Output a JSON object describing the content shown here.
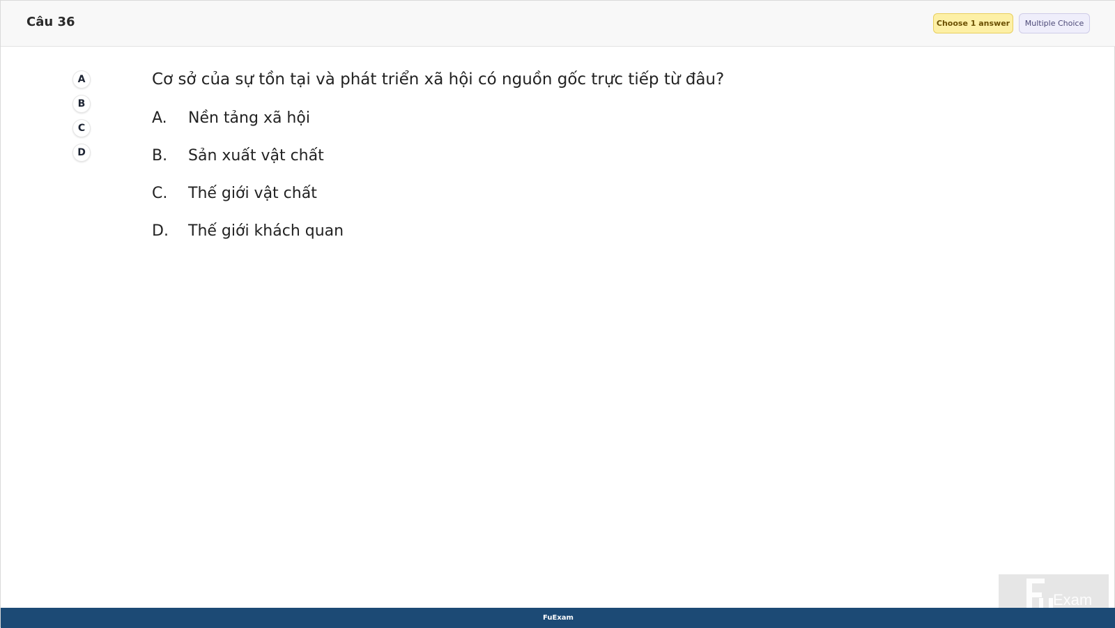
{
  "header": {
    "question_number": "Câu 36",
    "choose_badge": "Choose 1 answer",
    "type_badge": "Multiple Choice"
  },
  "answer_buttons": [
    "A",
    "B",
    "C",
    "D"
  ],
  "question": {
    "text": "Cơ sở của sự tồn tại và phát triển xã hội có nguồn gốc trực tiếp từ đâu?",
    "options": [
      {
        "letter": "A.",
        "text": "Nền tảng xã hội"
      },
      {
        "letter": "B.",
        "text": "Sản xuất vật chất"
      },
      {
        "letter": "C.",
        "text": "Thế giới vật chất"
      },
      {
        "letter": "D.",
        "text": "Thế giới khách quan"
      }
    ]
  },
  "footer": {
    "label": "FuExam"
  },
  "watermark": {
    "text": "Exam"
  }
}
